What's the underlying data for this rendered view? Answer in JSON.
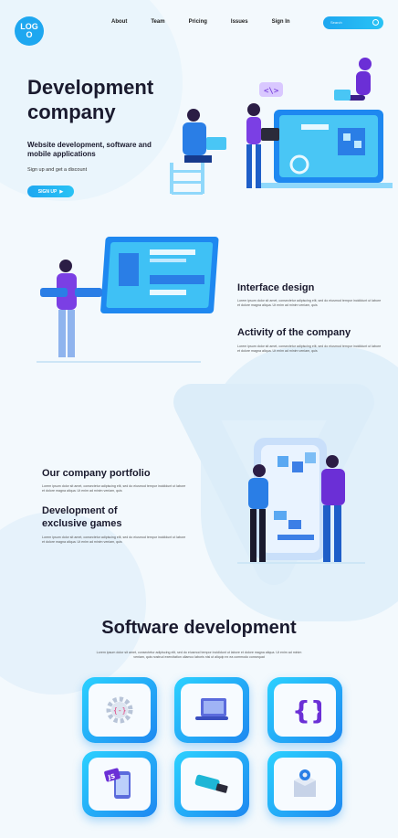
{
  "header": {
    "logo_text": "LOGO",
    "nav": [
      "About",
      "Team",
      "Pricing",
      "Issues",
      "Sign In"
    ],
    "search_placeholder": "Search"
  },
  "hero": {
    "title": "Development company",
    "subtitle": "Website development, software and mobile applications",
    "small": "Sign up and get a discount",
    "button": "SIGN UP"
  },
  "features": [
    {
      "title": "Interface design",
      "text": "Lorem ipsum dolor sit amet, consectetur adipiscing elit, sed do eiusmod tempor incididunt ut labore et dolore magna aliqua. Ut enim ad minim veniam, quis"
    },
    {
      "title": "Activity of the company",
      "text": "Lorem ipsum dolor sit amet, consectetur adipiscing elit, sed do eiusmod tempor incididunt ut labore et dolore magna aliqua. Ut enim ad minim veniam, quis"
    },
    {
      "title": "Our company portfolio",
      "text": "Lorem ipsum dolor sit amet, consectetur adipiscing elit, sed do eiusmod tempor incididunt ut labore et dolore magna aliqua. Ut enim ad minim veniam, quis"
    },
    {
      "title": "Development of exclusive games",
      "text": "Lorem ipsum dolor sit amet, consectetur adipiscing elit, sed do eiusmod tempor incididunt ut labore et dolore magna aliqua. Ut enim ad minim veniam, quis"
    }
  ],
  "software": {
    "title": "Software development",
    "text": "Lorem ipsum dolor sit amet, consectetur adipiscing elit, sed do eiusmod tempor incididunt ut labore et dolore magna aliqua. Ut enim ad minim veniam, quis nostrud exercitation ullamco laboris nisi ut aliquip ex ea commodo consequat"
  },
  "tiles": [
    "settings-code-icon",
    "laptop-icon",
    "code-braces-icon",
    "js-phone-icon",
    "usb-drive-icon",
    "package-icon"
  ],
  "colors": {
    "accent": "#1ea7f0",
    "accent2": "#29c3f5",
    "purple": "#6b2fd6",
    "dark": "#1a1a2e"
  }
}
